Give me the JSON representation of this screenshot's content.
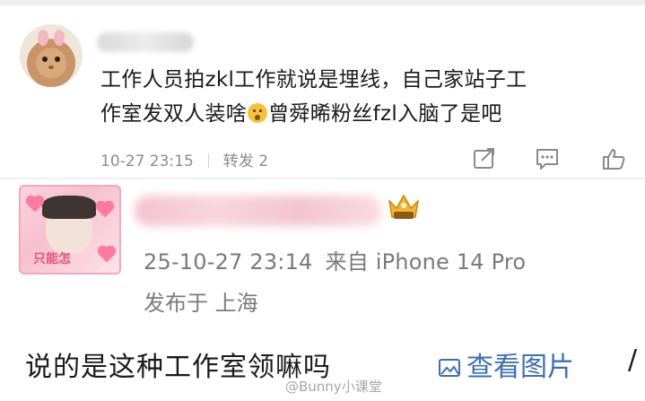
{
  "comment1": {
    "line1": "工作人员拍zkl工作就说是埋线，自己家站子工",
    "line2_a": "作室发双人装啥",
    "line2_b": "曾舜晞粉丝fzl入脑了是吧",
    "time": "10-27 23:15",
    "repost": "转发 2"
  },
  "comment2": {
    "avatar_caption": "只能怎",
    "time": "25-10-27 23:14",
    "source": "来自 iPhone 14 Pro",
    "location": "发布于 上海"
  },
  "bottom": {
    "text": "说的是这种工作室领嘛吗",
    "view_image": "查看图片",
    "slash": "/"
  },
  "watermark": "@Bunny小课堂",
  "icons": [
    "share-icon",
    "comment-icon",
    "like-icon",
    "crown-badge-icon",
    "image-icon",
    "emoji-icon"
  ],
  "colors": {
    "link": "#3d6fb5",
    "meta": "#8c8c8c",
    "text": "#1a1a1a"
  }
}
